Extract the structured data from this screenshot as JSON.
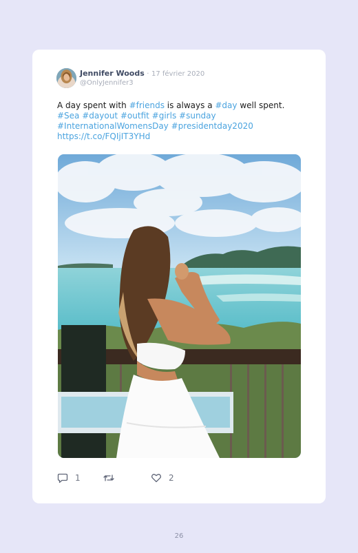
{
  "tweet": {
    "author_name": "Jennifer Woods",
    "separator": "·",
    "date": "17 février 2020",
    "handle": "@OnlyJennifer3",
    "text": {
      "part1": "A day spent with ",
      "tag_friends": "#friends",
      "part2": " is always a ",
      "tag_day": "#day",
      "part3": " well spent.",
      "tag_sea": "#Sea",
      "tag_dayout": "#dayout",
      "tag_outfit": "#outfit",
      "tag_girls": "#girls",
      "tag_sunday": "#sunday",
      "tag_iwd": "#InternationalWomensDay",
      "tag_presidentday": "#presidentday2020",
      "link": "https://t.co/FQIjIT3YHd"
    },
    "actions": {
      "reply_count": "1",
      "retweet_count": "",
      "like_count": "2"
    }
  },
  "page_number": "26",
  "colors": {
    "page_background": "#e6e6f8",
    "card_background": "#ffffff",
    "hashtag": "#4aa3df",
    "author_name": "#3f4a63",
    "muted": "#a8adb9"
  },
  "icons": {
    "reply": "reply-icon",
    "retweet": "retweet-icon",
    "like": "heart-icon"
  }
}
